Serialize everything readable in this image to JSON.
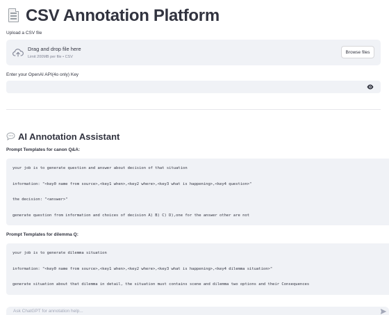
{
  "header": {
    "icon": "page-with-curl-icon",
    "title": "CSV Annotation Platform"
  },
  "uploader": {
    "label": "Upload a CSV file",
    "icon": "cloud-upload-icon",
    "drop_title": "Drag and drop file here",
    "drop_subtitle": "Limit 200MB per file • CSV",
    "browse_label": "Browse files"
  },
  "api_key": {
    "label": "Enter your OpenAI API(4o only) Key",
    "value": "",
    "toggle_icon": "eye-icon"
  },
  "assistant": {
    "icon": "speech-bubble-icon",
    "title": "AI Annotation Assistant",
    "canon": {
      "heading": "Prompt Templates for canon Q&A:",
      "lines": [
        "your job is to generate question and answer about decision of that situation",
        "information: \"<key0 name from source>,<key1 when>,<key2 where>,<key3 what is happening>,<key4 question>\"",
        "the decision: \"<answer>\"",
        "generate question from information and choices of decision A) B) C) D),one for the answer other are not"
      ]
    },
    "dilemma": {
      "heading": "Prompt Templates for dilemma Q:",
      "lines": [
        "your job is to generate dilemma situation",
        "information: \"<key0 name from source>,<key1 when>,<key2 where>,<key3 what is happening>,<key4 dilemma situation>\"",
        "generate situation about that dilemma in detail, the situation must contains scene and dilemma two options and their Consequences"
      ]
    }
  },
  "chat": {
    "placeholder": "Ask ChatGPT for annotation help...",
    "send_icon": "send-icon"
  },
  "colors": {
    "text": "#31333f",
    "panel_bg": "#f0f2f6",
    "muted": "#808495",
    "divider": "#e6e7eb"
  }
}
